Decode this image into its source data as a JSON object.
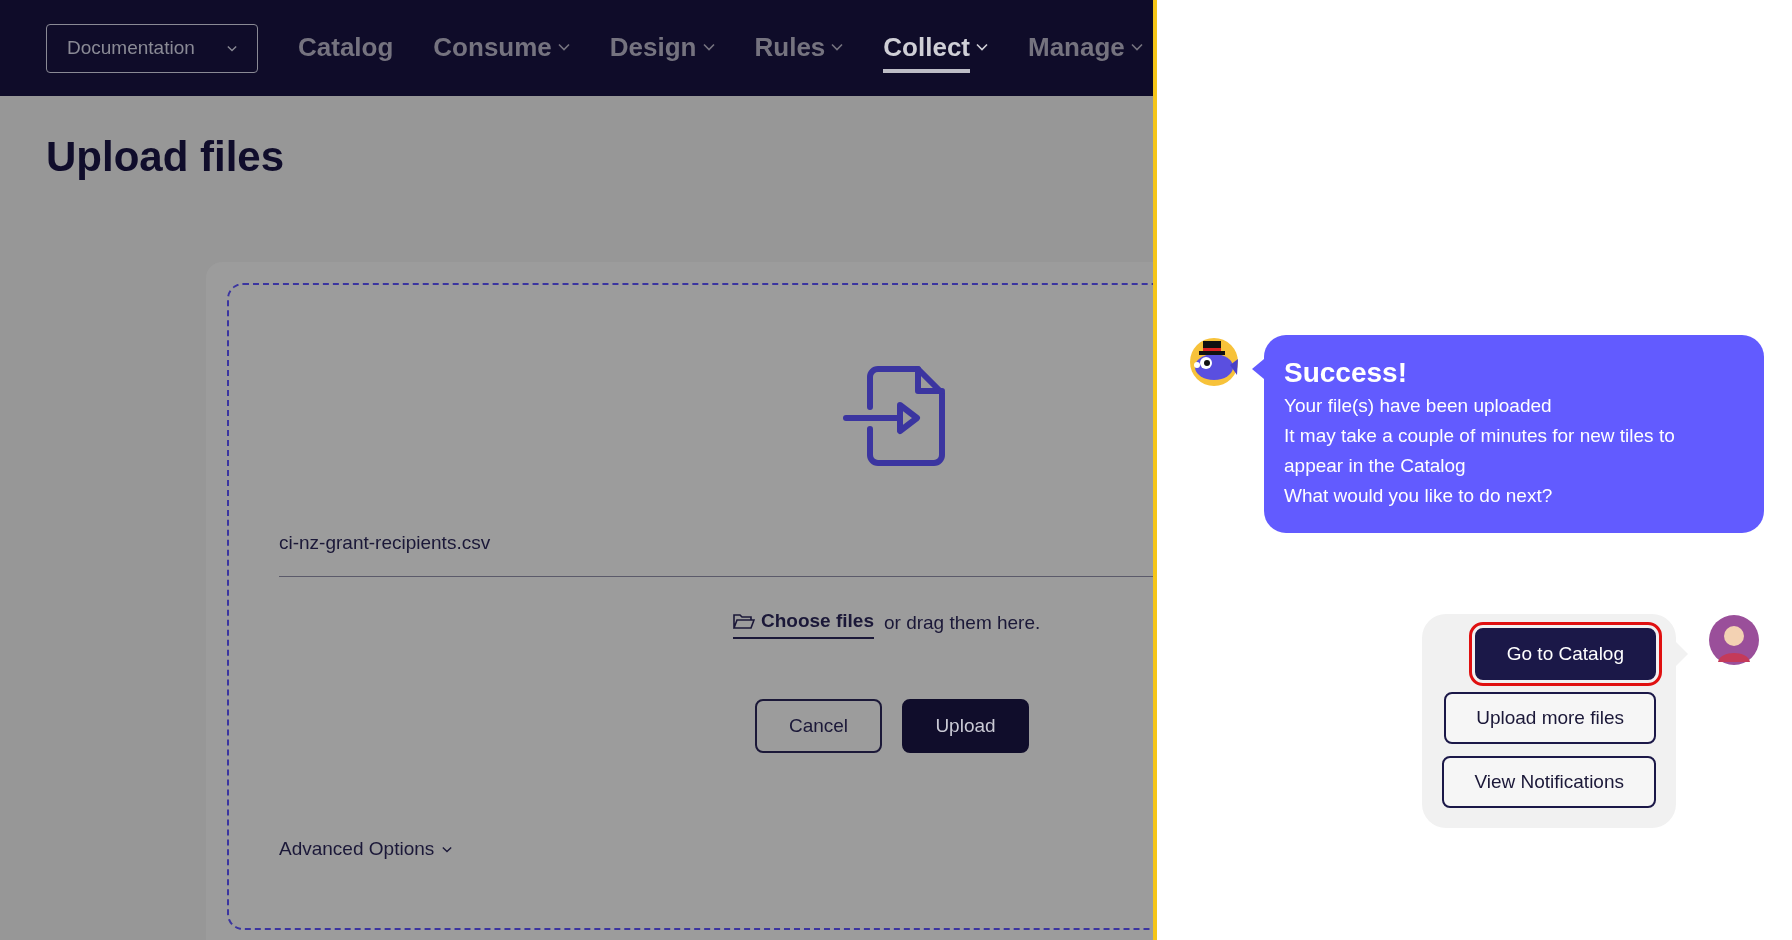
{
  "nav": {
    "selector": "Documentation",
    "items": [
      {
        "label": "Catalog",
        "dropdown": false,
        "selected": false
      },
      {
        "label": "Consume",
        "dropdown": true,
        "selected": false
      },
      {
        "label": "Design",
        "dropdown": true,
        "selected": false
      },
      {
        "label": "Rules",
        "dropdown": true,
        "selected": false
      },
      {
        "label": "Collect",
        "dropdown": true,
        "selected": true
      },
      {
        "label": "Manage",
        "dropdown": true,
        "selected": false
      }
    ]
  },
  "page": {
    "title": "Upload files"
  },
  "upload": {
    "file_name": "ci-nz-grant-recipients.csv",
    "choose_link": "Choose files",
    "drag_text": "or drag them here.",
    "buttons": [
      {
        "label": "Cancel",
        "kind": "outline"
      },
      {
        "label": "Upload",
        "kind": "primary"
      }
    ],
    "advanced_options": "Advanced Options"
  },
  "chat": {
    "bot_message": {
      "title": "Success!",
      "lines": [
        "Your file(s) have been uploaded",
        "It may take a couple of minutes for new tiles to appear in the Catalog",
        "What would you like to do next?"
      ]
    },
    "options": [
      {
        "label": "Go to Catalog",
        "kind": "primary",
        "highlighted": true
      },
      {
        "label": "Upload more files",
        "kind": "outline",
        "highlighted": false
      },
      {
        "label": "View Notifications",
        "kind": "outline",
        "highlighted": false
      }
    ]
  }
}
